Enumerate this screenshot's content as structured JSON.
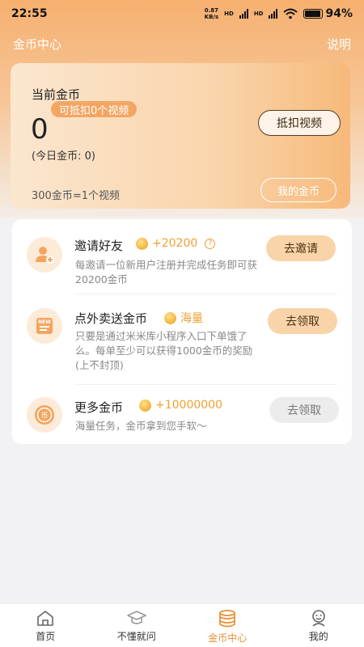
{
  "status_bar": {
    "time": "22:55",
    "net_speed_value": "0.87",
    "net_speed_unit": "KB/s",
    "hd1": "HD",
    "hd2": "HD",
    "battery": "94%"
  },
  "header": {
    "title": "金币中心",
    "help": "说明"
  },
  "coin_card": {
    "label": "当前金币",
    "pill": "可抵扣0个视频",
    "amount": "0",
    "today": "(今日金币: 0)",
    "redeem_button": "抵扣视频",
    "rate": "300金币=1个视频",
    "my_coins_button": "我的金币"
  },
  "tasks": [
    {
      "title": "邀请好友",
      "reward": "+20200",
      "desc": "每邀请一位新用户注册并完成任务即可获20200金币",
      "button": "去邀请",
      "icon": "invite-user-icon"
    },
    {
      "title": "点外卖送金币",
      "reward": "海量",
      "desc": "只要是通过米米库小程序入口下单饿了么。每单至少可以获得1000金币的奖励(上不封顶)",
      "button": "去领取",
      "icon": "new-badge-icon"
    },
    {
      "title": "更多金币",
      "reward": "+10000000",
      "desc": "海量任务，金币拿到您手软～",
      "button": "去领取",
      "icon": "coin-icon"
    }
  ],
  "tabbar": {
    "tabs": [
      {
        "label": "首页",
        "icon": "home-icon"
      },
      {
        "label": "不懂就问",
        "icon": "graduation-cap-icon"
      },
      {
        "label": "金币中心",
        "icon": "coin-stack-icon"
      },
      {
        "label": "我的",
        "icon": "profile-icon"
      }
    ],
    "active_index": 2,
    "active_color": "#e8923a"
  }
}
